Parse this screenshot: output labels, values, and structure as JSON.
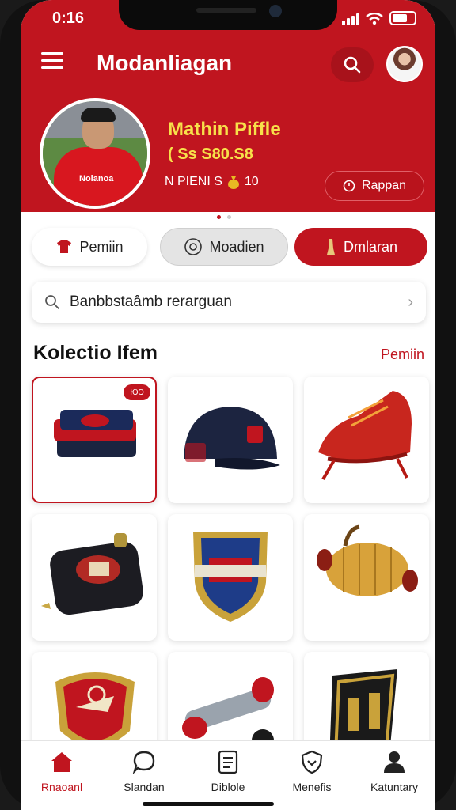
{
  "status_bar": {
    "time": "0:16"
  },
  "header": {
    "menu_icon": "hamburger-menu-icon",
    "app_title": "Modanliagan",
    "search_icon": "search-icon",
    "avatar_icon": "user-avatar"
  },
  "profile": {
    "jersey_text": "Nolanoa",
    "name": "Mathin Piffle",
    "price": "( Ss S80.S8",
    "stat_prefix": "N PIENI S",
    "stat_icon": "money-bag-icon",
    "stat_value": "10",
    "reward_button": "Rappan",
    "reward_icon": "clock-icon"
  },
  "chips": [
    {
      "label": "Pemiin",
      "icon": "jersey-icon",
      "selected": false
    },
    {
      "label": "Moadien",
      "icon": "at-icon",
      "selected": false
    },
    {
      "label": "Dmlaran",
      "icon": "trophy-icon",
      "selected": true
    }
  ],
  "search": {
    "text": "Banbbstaâmb rerarguan",
    "icon": "search-icon",
    "chevron": "chevron-right-icon"
  },
  "collection": {
    "title": "Kolectio Ifem",
    "link": "Pemiin",
    "items": [
      {
        "name": "folded-jerseys",
        "badge": "ЮЭ",
        "selected": true
      },
      {
        "name": "navy-cap",
        "badge": "",
        "selected": false
      },
      {
        "name": "red-football-boot",
        "badge": "",
        "selected": false
      },
      {
        "name": "black-wallet",
        "badge": "",
        "selected": false
      },
      {
        "name": "club-shield-crest",
        "badge": "",
        "selected": false
      },
      {
        "name": "woven-bag",
        "badge": "",
        "selected": false
      },
      {
        "name": "red-shield-badge",
        "badge": "",
        "selected": false
      },
      {
        "name": "torch-keychain",
        "badge": "",
        "selected": false
      },
      {
        "name": "gold-crest-badge",
        "badge": "",
        "selected": false
      }
    ]
  },
  "bottom_nav": [
    {
      "label": "Rnaoanl",
      "icon": "home-icon",
      "active": true
    },
    {
      "label": "Slandan",
      "icon": "chat-icon",
      "active": false
    },
    {
      "label": "Diblole",
      "icon": "document-icon",
      "active": false
    },
    {
      "label": "Menefis",
      "icon": "shield-icon",
      "active": false
    },
    {
      "label": "Katuntary",
      "icon": "person-icon",
      "active": false
    }
  ],
  "colors": {
    "primary": "#c0151f",
    "accent_text": "#f7e04a"
  }
}
